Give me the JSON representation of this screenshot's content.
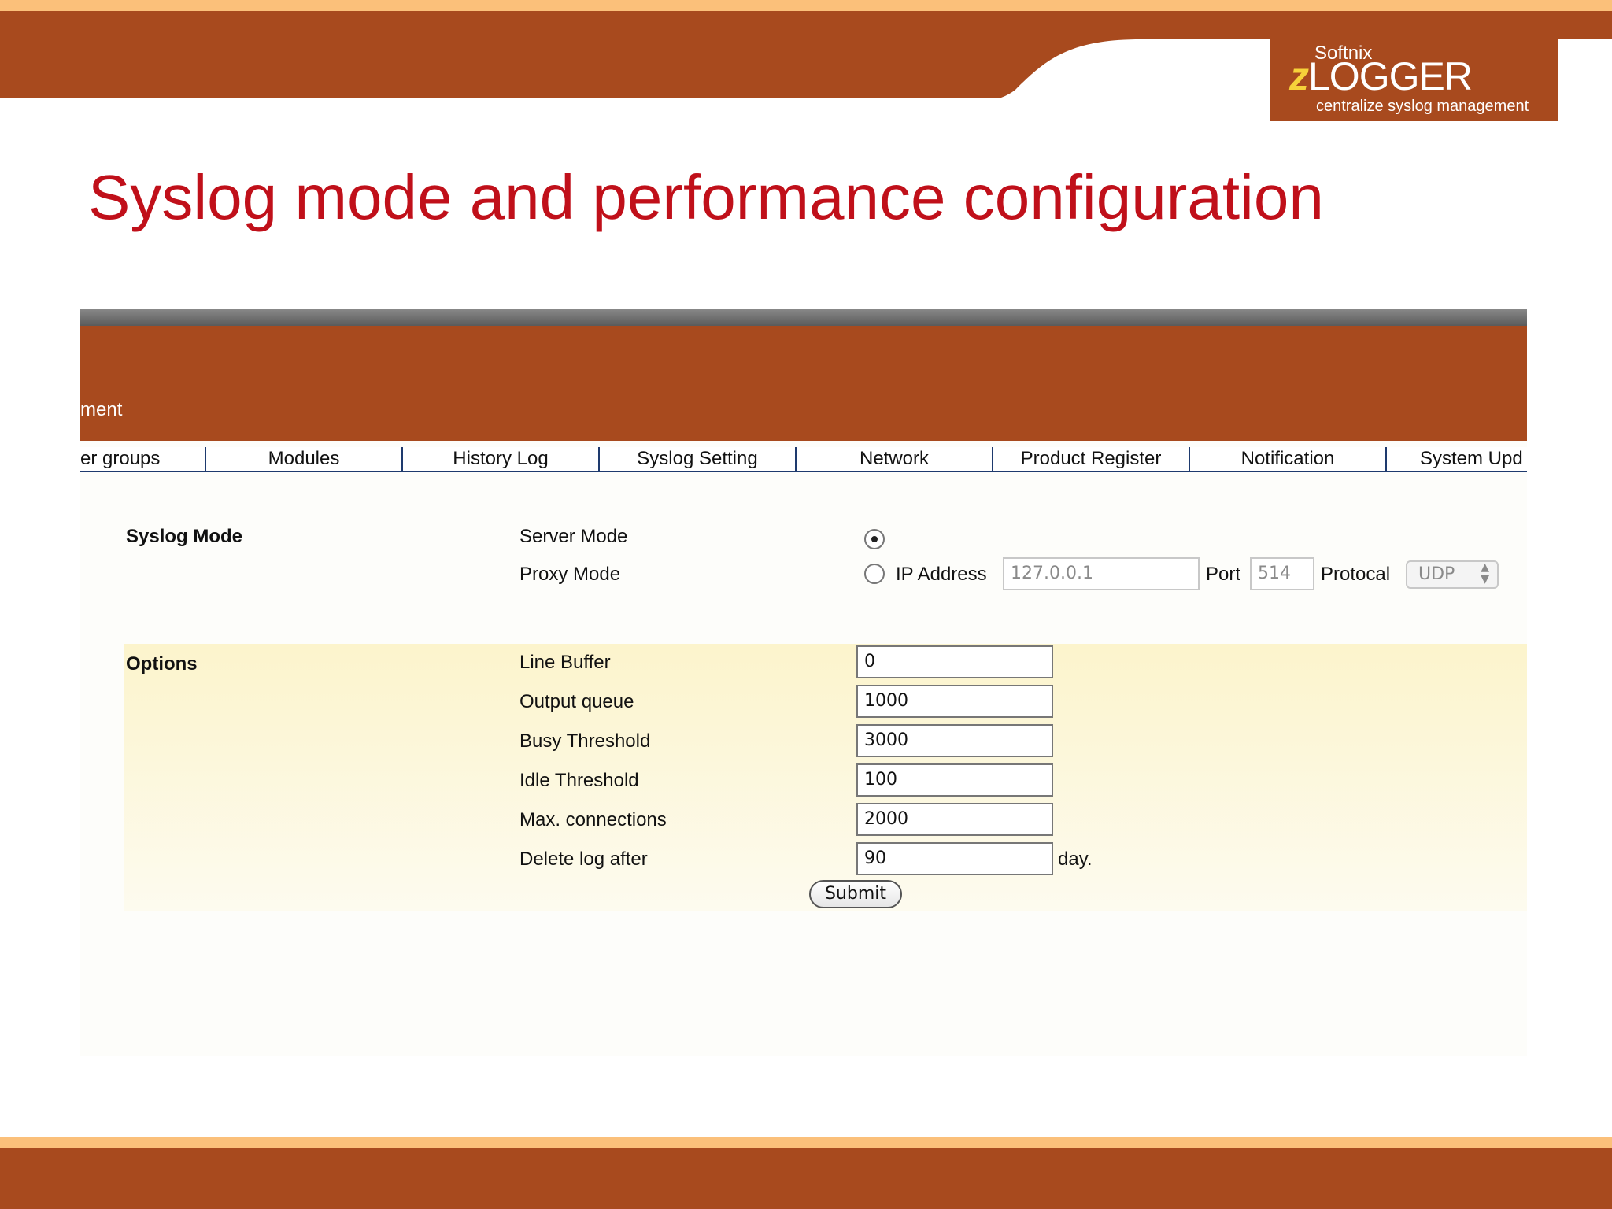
{
  "logo": {
    "brand": "Softnix",
    "name": "LOGGER",
    "tagline": "centralize syslog management"
  },
  "slide": {
    "title": "Syslog mode and performance configuration"
  },
  "app": {
    "banner_text": "ment",
    "nav": [
      {
        "label": "er groups"
      },
      {
        "label": "Modules"
      },
      {
        "label": "History Log"
      },
      {
        "label": "Syslog Setting"
      },
      {
        "label": "Network"
      },
      {
        "label": "Product Register"
      },
      {
        "label": "Notification"
      },
      {
        "label": "System Upd"
      }
    ]
  },
  "syslog_mode": {
    "section_label": "Syslog Mode",
    "server_mode_label": "Server Mode",
    "proxy_mode_label": "Proxy Mode",
    "selected": "Server Mode",
    "ip_label": "IP Address",
    "ip_value": "127.0.0.1",
    "port_label": "Port",
    "port_value": "514",
    "protocol_label": "Protocal",
    "protocol_value": "UDP"
  },
  "options": {
    "section_label": "Options",
    "fields": [
      {
        "label": "Line Buffer",
        "value": "0"
      },
      {
        "label": "Output queue",
        "value": "1000"
      },
      {
        "label": "Busy Threshold",
        "value": "3000"
      },
      {
        "label": "Idle Threshold",
        "value": "100"
      },
      {
        "label": "Max. connections",
        "value": "2000"
      },
      {
        "label": "Delete log after",
        "value": "90",
        "unit": "day."
      }
    ],
    "submit_label": "Submit"
  },
  "colors": {
    "brand": "#a84a1e",
    "accent_strip": "#fbc07a",
    "title": "#c0101a",
    "nav_border": "#1e3a6e"
  }
}
